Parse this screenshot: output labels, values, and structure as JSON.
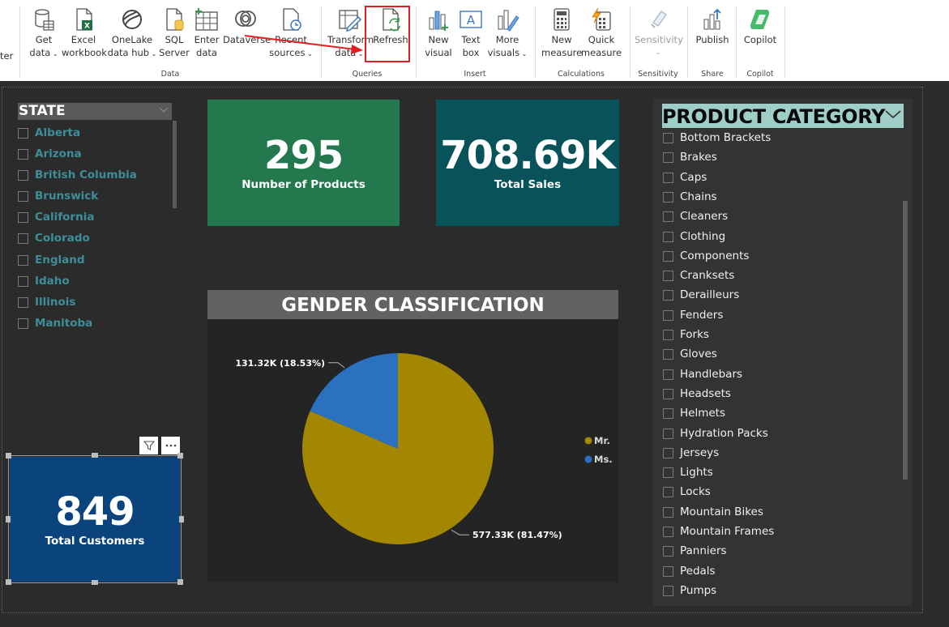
{
  "ribbon": {
    "left_fragment": "ter",
    "buttons": {
      "get_data": {
        "l1": "Get",
        "l2": "data"
      },
      "excel": {
        "l1": "Excel",
        "l2": "workbook"
      },
      "onelake": {
        "l1": "OneLake",
        "l2": "data hub"
      },
      "sql": {
        "l1": "SQL",
        "l2": "Server"
      },
      "enter_data": {
        "l1": "Enter",
        "l2": "data"
      },
      "dataverse": {
        "l1": "Dataverse"
      },
      "recent": {
        "l1": "Recent",
        "l2": "sources"
      },
      "transform": {
        "l1": "Transform",
        "l2": "data"
      },
      "refresh": {
        "l1": "Refresh"
      },
      "new_visual": {
        "l1": "New",
        "l2": "visual"
      },
      "text_box": {
        "l1": "Text",
        "l2": "box"
      },
      "more_visuals": {
        "l1": "More",
        "l2": "visuals"
      },
      "new_measure": {
        "l1": "New",
        "l2": "measure"
      },
      "quick_measure": {
        "l1": "Quick",
        "l2": "measure"
      },
      "sensitivity": {
        "l1": "Sensitivity"
      },
      "publish": {
        "l1": "Publish"
      },
      "copilot": {
        "l1": "Copilot"
      }
    },
    "groups": {
      "data": "Data",
      "queries": "Queries",
      "insert": "Insert",
      "calculations": "Calculations",
      "sensitivity": "Sensitivity",
      "share": "Share",
      "copilot": "Copilot"
    }
  },
  "state_slicer": {
    "title": "STATE",
    "items": [
      "Alberta",
      "Arizona",
      "British Columbia",
      "Brunswick",
      "California",
      "Colorado",
      "England",
      "Idaho",
      "Illinois",
      "Manitoba"
    ]
  },
  "cards": {
    "products": {
      "value": "295",
      "label": "Number of Products"
    },
    "sales": {
      "value": "708.69K",
      "label": "Total Sales"
    },
    "customers": {
      "value": "849",
      "label": "Total Customers"
    }
  },
  "pie": {
    "title": "GENDER CLASSIFICATION",
    "legend": [
      {
        "name": "Mr.",
        "color": "#a38700"
      },
      {
        "name": "Ms.",
        "color": "#2a72bf"
      }
    ],
    "slices": [
      {
        "name": "Mr.",
        "value": 577.33,
        "percent": 81.47,
        "label": "577.33K (81.47%)",
        "color": "#a38700"
      },
      {
        "name": "Ms.",
        "value": 131.32,
        "percent": 18.53,
        "label": "131.32K (18.53%)",
        "color": "#2a72bf"
      }
    ]
  },
  "product_slicer": {
    "title": "PRODUCT CATEGORY",
    "items": [
      "Bottom Brackets",
      "Brakes",
      "Caps",
      "Chains",
      "Cleaners",
      "Clothing",
      "Components",
      "Cranksets",
      "Derailleurs",
      "Fenders",
      "Forks",
      "Gloves",
      "Handlebars",
      "Headsets",
      "Helmets",
      "Hydration Packs",
      "Jerseys",
      "Lights",
      "Locks",
      "Mountain Bikes",
      "Mountain Frames",
      "Panniers",
      "Pedals",
      "Pumps"
    ]
  },
  "colors": {
    "canvas_bg": "#2b2b2b",
    "card_products": "#23784e",
    "card_sales": "#08525a",
    "card_customers": "#0b447d",
    "highlight": "#e02020"
  }
}
